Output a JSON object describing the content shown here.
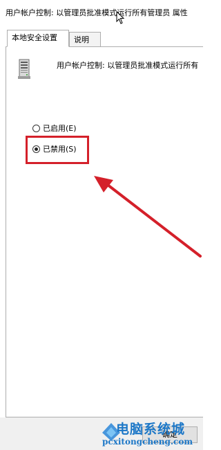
{
  "window": {
    "title": "用户帐户控制: 以管理员批准模式运行所有管理员 属性"
  },
  "tabs": [
    {
      "label": "本地安全设置",
      "active": true
    },
    {
      "label": "说明",
      "active": false
    }
  ],
  "policy": {
    "icon": "server-policy-icon",
    "title": "用户帐户控制: 以管理员批准模式运行所有"
  },
  "options": [
    {
      "label": "已启用(E)",
      "checked": false
    },
    {
      "label": "已禁用(S)",
      "checked": true
    }
  ],
  "buttons": {
    "ok_label": "确定"
  },
  "annotation": {
    "highlight_color": "#d4202a",
    "arrow_color": "#d4202a"
  },
  "watermark": {
    "title": "电脑系统城",
    "url": "pcxitongcheng.com",
    "color": "#1c77c7"
  }
}
